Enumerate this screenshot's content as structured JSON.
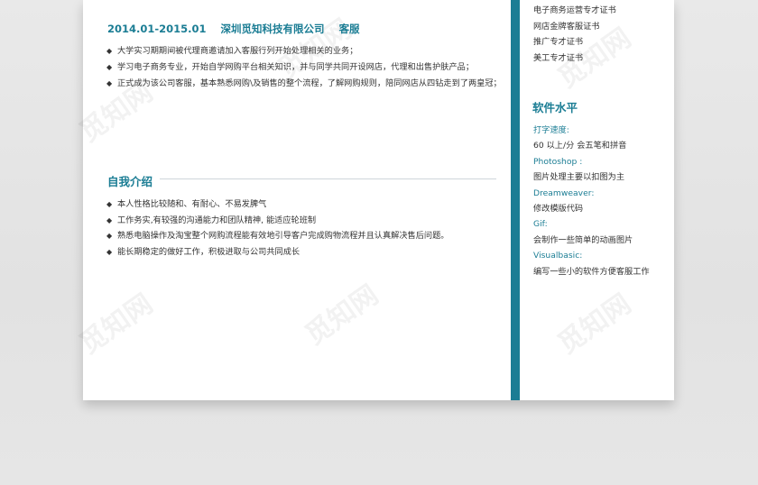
{
  "experience": {
    "period": "2014.01-2015.01",
    "company": "深圳觅知科技有限公司",
    "role": "客服",
    "bullets": [
      "大学实习期期间被代理商邀请加入客服行列开始处理相关的业务；",
      "学习电子商务专业，开始自学网购平台相关知识，并与同学共同开设网店，代理和出售护肤产品；",
      "正式成为该公司客服，基本熟悉网购\\及销售的整个流程，了解网购规则，陪同网店从四钻走到了两皇冠；"
    ]
  },
  "intro": {
    "title": "自我介绍",
    "bullets": [
      "本人性格比较随和、有耐心、不易发脾气",
      "工作务实,有较强的沟通能力和团队精神, 能适应轮班制",
      "熟悉电脑操作及淘宝整个网购流程能有效地引导客户完成购物流程并且认真解决售后问题。",
      "能长期稳定的做好工作，积极进取与公司共同成长"
    ]
  },
  "certificates": [
    "电子商务运营专才证书",
    "网店金牌客服证书",
    "推广专才证书",
    "美工专才证书"
  ],
  "software": {
    "title": "软件水平",
    "items": [
      {
        "label": "打字速度:",
        "value": "60 以上/分  会五笔和拼音"
      },
      {
        "label": "Photoshop :",
        "value": "图片处理主要以扣图为主"
      },
      {
        "label": "Dreamweaver:",
        "value": "修改模版代码"
      },
      {
        "label": "Gif:",
        "value": "会制作一些简单的动画图片"
      },
      {
        "label": "Visualbasic:",
        "value": "编写一些小的软件方便客服工作"
      }
    ]
  },
  "bullet_glyph": "◆",
  "watermark": "觅知网",
  "colors": {
    "accent": "#1b7d94",
    "text": "#333333",
    "background": "#e6e6e6"
  }
}
